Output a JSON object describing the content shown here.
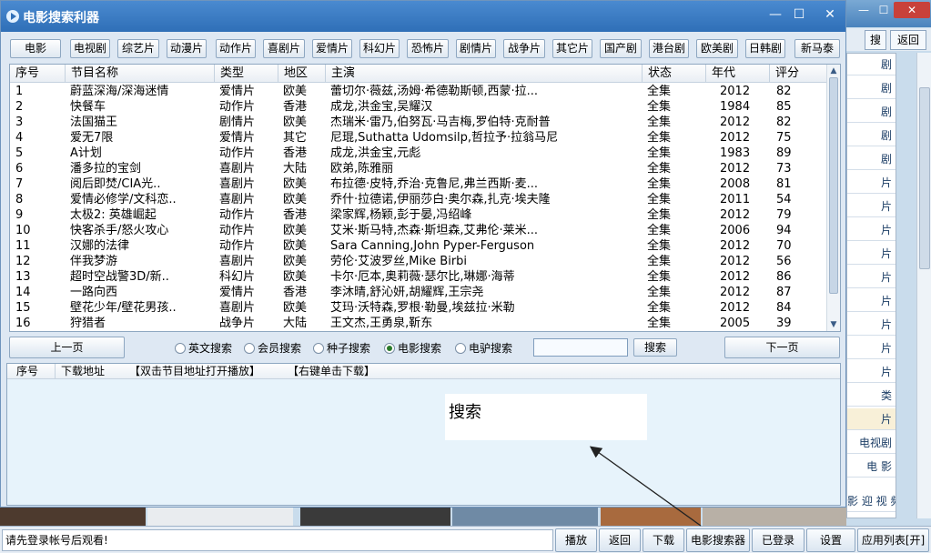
{
  "window": {
    "title": "电影搜索利器",
    "minimize_glyph": "—",
    "maximize_glyph": "☐",
    "close_glyph": "✕"
  },
  "background_window": {
    "minimize_glyph": "—",
    "maximize_glyph": "☐",
    "close_glyph": "✕",
    "tabs": [
      "搜",
      "返回"
    ],
    "list_items": [
      "剧",
      "剧",
      "剧",
      "剧",
      "剧",
      "片",
      "片",
      "片",
      "片",
      "片",
      "片",
      "片",
      "片",
      "片",
      "类",
      "片",
      "电视剧",
      "电 影",
      "影 迎 视 频"
    ],
    "highlight_index": 15
  },
  "categories": [
    "电影",
    "电视剧",
    "综艺片",
    "动漫片",
    "动作片",
    "喜剧片",
    "爱情片",
    "科幻片",
    "恐怖片",
    "剧情片",
    "战争片",
    "其它片",
    "国产剧",
    "港台剧",
    "欧美剧",
    "日韩剧",
    "新马泰"
  ],
  "table": {
    "columns": [
      "序号",
      "节目名称",
      "类型",
      "地区",
      "主演",
      "状态",
      "年代",
      "评分"
    ],
    "rows": [
      [
        "1",
        "蔚蓝深海/深海迷情",
        "爱情片",
        "欧美",
        "蕾切尔·薇兹,汤姆·希德勒斯顿,西蒙·拉...",
        "全集",
        "2012",
        "82"
      ],
      [
        "2",
        "快餐车",
        "动作片",
        "香港",
        "成龙,洪金宝,吴耀汉",
        "全集",
        "1984",
        "85"
      ],
      [
        "3",
        "法国猫王",
        "剧情片",
        "欧美",
        "杰瑞米·雷乃,伯努瓦·马吉梅,罗伯特·克耐普",
        "全集",
        "2012",
        "82"
      ],
      [
        "4",
        "爱无7限",
        "爱情片",
        "其它",
        "尼琨,Suthatta Udomsilp,哲拉予·拉翁马尼",
        "全集",
        "2012",
        "75"
      ],
      [
        "5",
        "A计划",
        "动作片",
        "香港",
        "成龙,洪金宝,元彪",
        "全集",
        "1983",
        "89"
      ],
      [
        "6",
        "潘多拉的宝剑",
        "喜剧片",
        "大陆",
        "欧弟,陈雅丽",
        "全集",
        "2012",
        "73"
      ],
      [
        "7",
        "阅后即焚/CIA光..",
        "喜剧片",
        "欧美",
        "布拉德·皮特,乔治·克鲁尼,弗兰西斯·麦...",
        "全集",
        "2008",
        "81"
      ],
      [
        "8",
        "爱情必修学/文科恋..",
        "喜剧片",
        "欧美",
        "乔什·拉德诺,伊丽莎白·奥尔森,扎克·埃夫隆",
        "全集",
        "2011",
        "54"
      ],
      [
        "9",
        "太极2: 英雄崛起",
        "动作片",
        "香港",
        "梁家辉,杨颖,彭于晏,冯绍峰",
        "全集",
        "2012",
        "79"
      ],
      [
        "10",
        "快客杀手/怒火攻心",
        "动作片",
        "欧美",
        "艾米·斯马特,杰森·斯坦森,艾弗伦·莱米...",
        "全集",
        "2006",
        "94"
      ],
      [
        "11",
        "汉娜的法律",
        "动作片",
        "欧美",
        "Sara Canning,John Pyper-Ferguson",
        "全集",
        "2012",
        "70"
      ],
      [
        "12",
        "伴我梦游",
        "喜剧片",
        "欧美",
        "劳伦·艾波罗丝,Mike Birbi",
        "全集",
        "2012",
        "56"
      ],
      [
        "13",
        "超时空战警3D/新..",
        "科幻片",
        "欧美",
        "卡尔·厄本,奥莉薇·瑟尔比,琳娜·海蒂",
        "全集",
        "2012",
        "86"
      ],
      [
        "14",
        "一路向西",
        "爱情片",
        "香港",
        "李沐晴,舒沁妍,胡耀辉,王宗尧",
        "全集",
        "2012",
        "87"
      ],
      [
        "15",
        "壁花少年/壁花男孩..",
        "喜剧片",
        "欧美",
        "艾玛·沃特森,罗根·勒曼,埃兹拉·米勒",
        "全集",
        "2012",
        "84"
      ],
      [
        "16",
        "狩猎者",
        "战争片",
        "大陆",
        "王文杰,王勇泉,靳东",
        "全集",
        "2005",
        "39"
      ]
    ]
  },
  "nav": {
    "prev": "上一页",
    "next": "下一页"
  },
  "search_modes": [
    {
      "label": "英文搜索",
      "selected": false
    },
    {
      "label": "会员搜索",
      "selected": false
    },
    {
      "label": "种子搜索",
      "selected": false
    },
    {
      "label": "电影搜索",
      "selected": true
    },
    {
      "label": "电驴搜索",
      "selected": false
    }
  ],
  "search": {
    "value": "",
    "button": "搜索"
  },
  "download_panel": {
    "headers": [
      "序号",
      "下载地址",
      "【双击节目地址打开播放】",
      "【右键单击下载】"
    ]
  },
  "tooltip": {
    "text": "搜索"
  },
  "status_bar": {
    "login_tip": "请先登录帐号后观看!"
  },
  "bottom_buttons": [
    "播放",
    "返回",
    "下载",
    "电影搜索器",
    "已登录",
    "设置",
    "应用列表[开]"
  ],
  "colors": {
    "title_bar": "#3a7cc4",
    "panel_bg": "#e7f3fb",
    "selected_radio": "#2a7a2a"
  }
}
